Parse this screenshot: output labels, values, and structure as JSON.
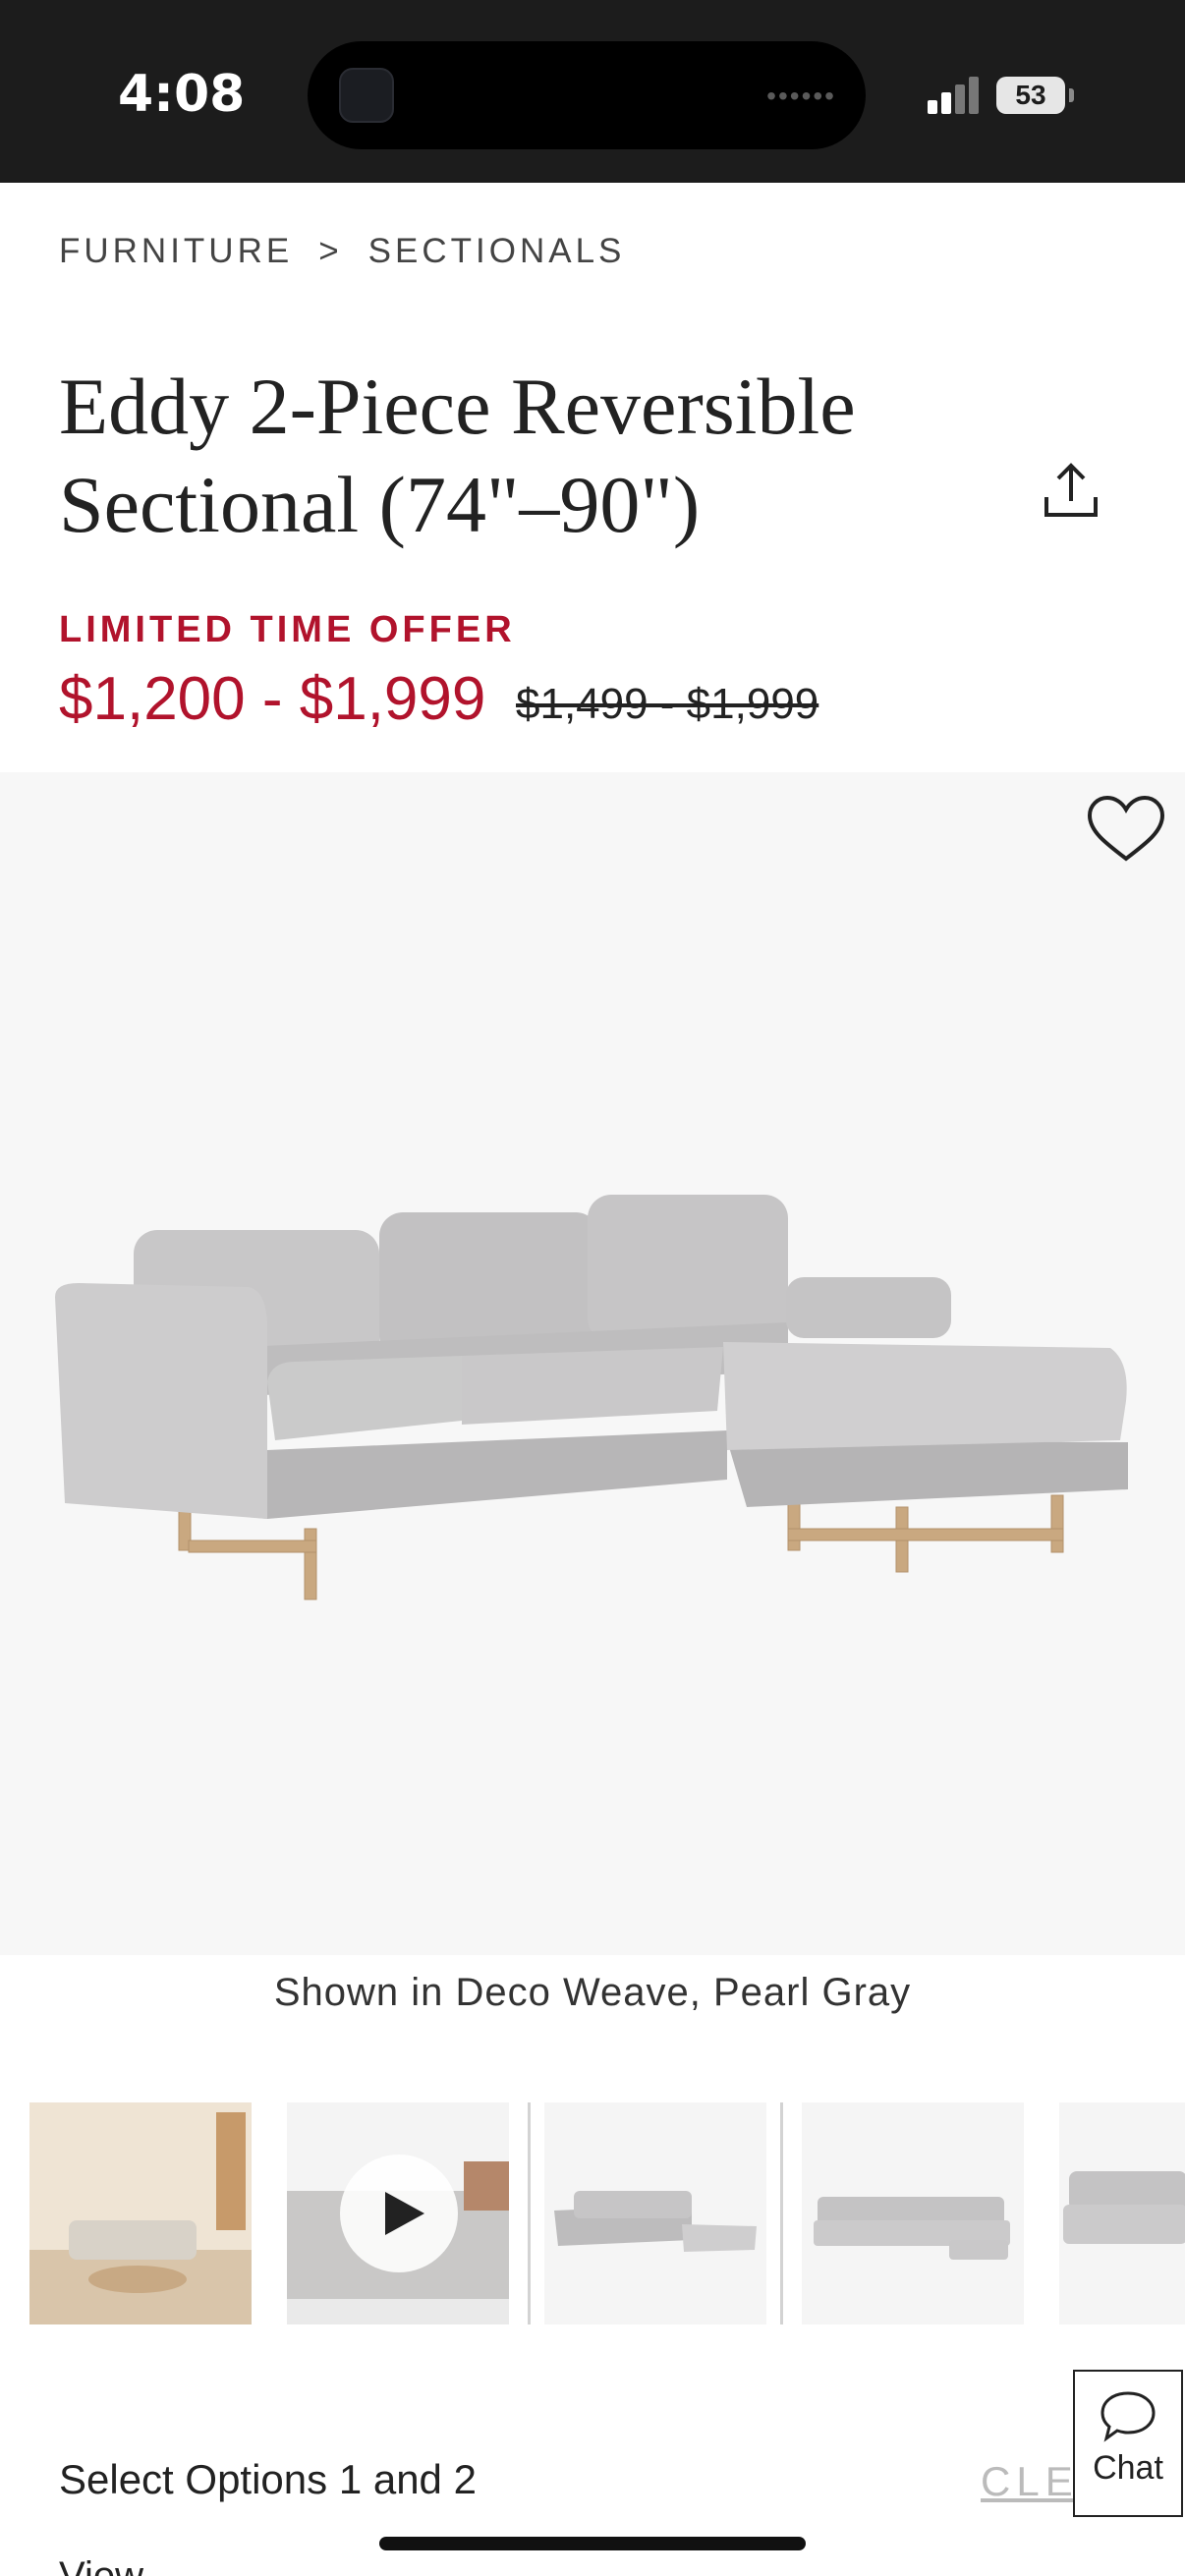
{
  "status_bar": {
    "time": "4:08",
    "battery": "53"
  },
  "breadcrumb": {
    "level1": "FURNITURE",
    "separator": ">",
    "level2": "SECTIONALS"
  },
  "product": {
    "title_line1": "Eddy 2-Piece Reversible",
    "title_line2": "Sectional (74\"–90\")",
    "offer_label": "LIMITED TIME OFFER",
    "sale_price": "$1,200 - $1,999",
    "original_price": "$1,499 - $1,999",
    "caption": "Shown in Deco Weave, Pearl Gray"
  },
  "thumbnails": [
    {
      "name": "living-room-scene",
      "selected": false
    },
    {
      "name": "video",
      "selected": false
    },
    {
      "name": "front-angle",
      "selected": true
    },
    {
      "name": "front-view",
      "selected": false
    },
    {
      "name": "side-view",
      "selected": false
    }
  ],
  "options": {
    "label": "Select Options 1 and 2",
    "clear_label": "CLEA",
    "view_label": "View"
  },
  "chat": {
    "label": "Chat"
  },
  "colors": {
    "accent_red": "#b1132c",
    "status_bar": "#1c1c1c",
    "hero_bg": "#f7f7f7"
  }
}
